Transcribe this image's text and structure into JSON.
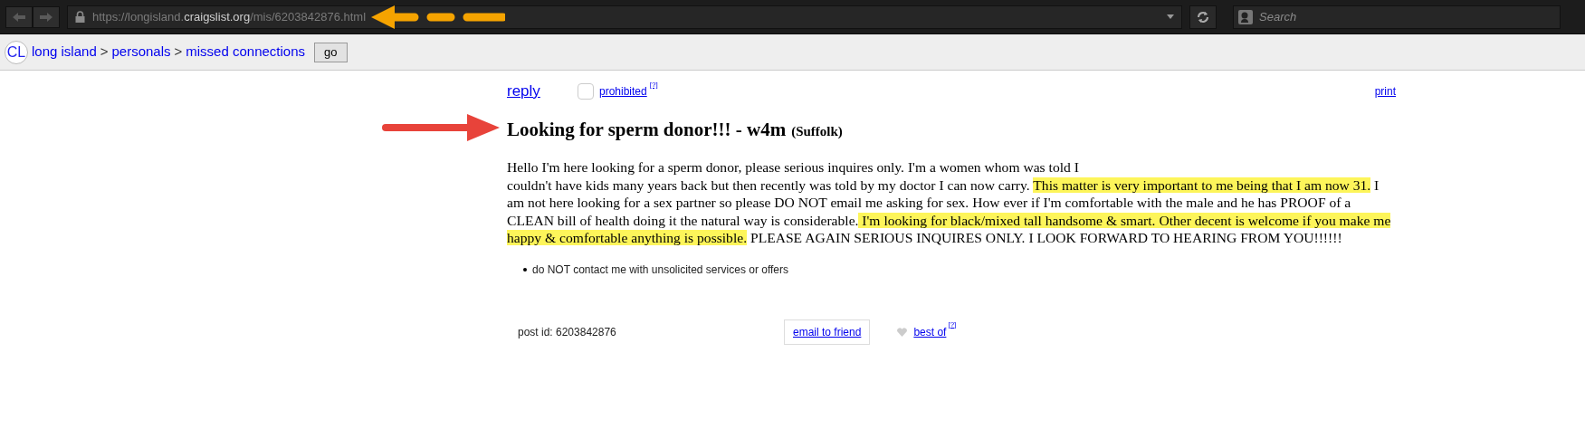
{
  "browser": {
    "url_host_prefix": "https://longisland.",
    "url_host_domain": "craigslist.org",
    "url_path": "/mis/6203842876.html",
    "search_placeholder": "Search"
  },
  "nav": {
    "logo": "CL",
    "breadcrumbs": [
      {
        "label": "long island",
        "separator": ">"
      },
      {
        "label": "personals",
        "separator": ">"
      },
      {
        "label": "missed connections"
      }
    ],
    "go_button": "go"
  },
  "post": {
    "reply": "reply",
    "prohibited": {
      "label": "prohibited",
      "checked": false,
      "help": "[?]"
    },
    "print": "print",
    "title": "Looking for sperm donor!!! - w4m",
    "location": "(Suffolk)",
    "body": [
      {
        "text": "Hello I'm here looking for a sperm donor, please serious inquires only. I'm a women whom was told I",
        "highlighted": false,
        "line_break_after": true
      },
      {
        "text": "couldn't have kids many years back but then recently was told by my doctor I can now carry. ",
        "highlighted": false,
        "line_break_after": false
      },
      {
        "text": "This matter is very important to me being that I am now 31.",
        "highlighted": true,
        "line_break_after": false
      },
      {
        "text": " I am not here looking for a sex partner so please DO NOT email me asking for sex. How ever if I'm comfortable with the male and he has PROOF of a CLEAN bill of health doing it the natural way is considerable.",
        "highlighted": false,
        "line_break_after": false
      },
      {
        "text": " I'm looking for black/mixed tall handsome & smart. Other decent is welcome if you make me happy & comfortable anything is possible.",
        "highlighted": true,
        "line_break_after": false
      },
      {
        "text": " PLEASE AGAIN SERIOUS INQUIRES ONLY. I LOOK FORWARD TO HEARING FROM YOU!!!!!!",
        "highlighted": false,
        "line_break_after": false
      }
    ],
    "notices": [
      "do NOT contact me with unsolicited services or offers"
    ],
    "post_id": "post id: 6203842876",
    "email_to_friend": "email to friend",
    "best_of": {
      "label": "best of",
      "help": "[?]"
    }
  }
}
